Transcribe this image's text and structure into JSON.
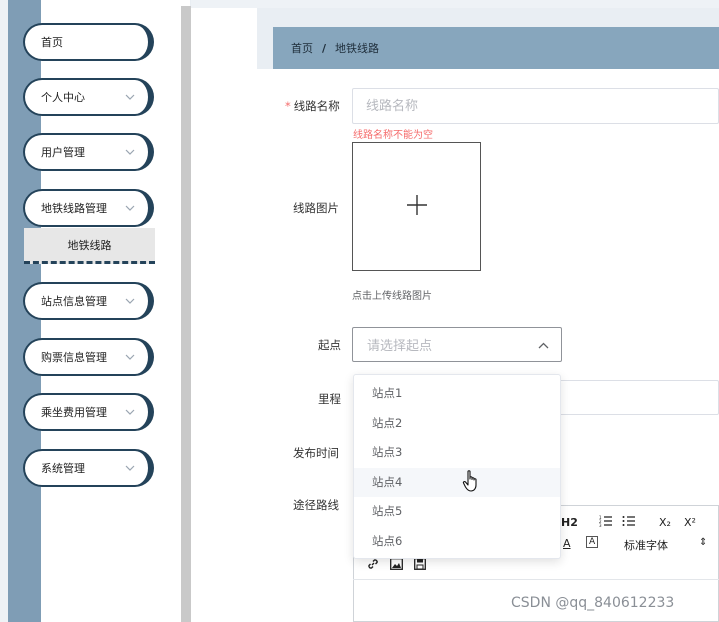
{
  "sidebar": {
    "items": [
      {
        "label": "首页"
      },
      {
        "label": "个人中心"
      },
      {
        "label": "用户管理"
      },
      {
        "label": "地铁线路管理"
      },
      {
        "label": "站点信息管理"
      },
      {
        "label": "购票信息管理"
      },
      {
        "label": "乘坐费用管理"
      },
      {
        "label": "系统管理"
      }
    ],
    "submenu": {
      "label": "地铁线路"
    }
  },
  "breadcrumb": {
    "home": "首页",
    "separator": "/",
    "current": "地铁线路"
  },
  "form": {
    "name": {
      "required_mark": "*",
      "label": "线路名称",
      "placeholder": "线路名称",
      "error": "线路名称不能为空"
    },
    "image": {
      "label": "线路图片",
      "hint": "点击上传线路图片"
    },
    "start": {
      "label": "起点",
      "placeholder": "请选择起点"
    },
    "mileage": {
      "label": "里程"
    },
    "publish_time": {
      "label": "发布时间"
    },
    "route": {
      "label": "途径路线"
    }
  },
  "editor": {
    "h2": "H2",
    "ordered_list_icon": "ordered-list-icon",
    "unordered_list_icon": "unordered-list-icon",
    "subscript": "X₂",
    "superscript": "X²",
    "font_color": "A",
    "bg_color": "A",
    "font_select": "标准字体",
    "font_select_arrow": "⇕"
  },
  "dropdown": {
    "options": [
      "站点1",
      "站点2",
      "站点3",
      "站点4",
      "站点5",
      "站点6"
    ],
    "hovered_index": 3
  },
  "watermark": "CSDN @qq_840612233",
  "colors": {
    "sidebar_band": "#7f9db5",
    "menu_border": "#24435a",
    "header_bg": "#87a6bd",
    "error": "#f56c6c"
  }
}
